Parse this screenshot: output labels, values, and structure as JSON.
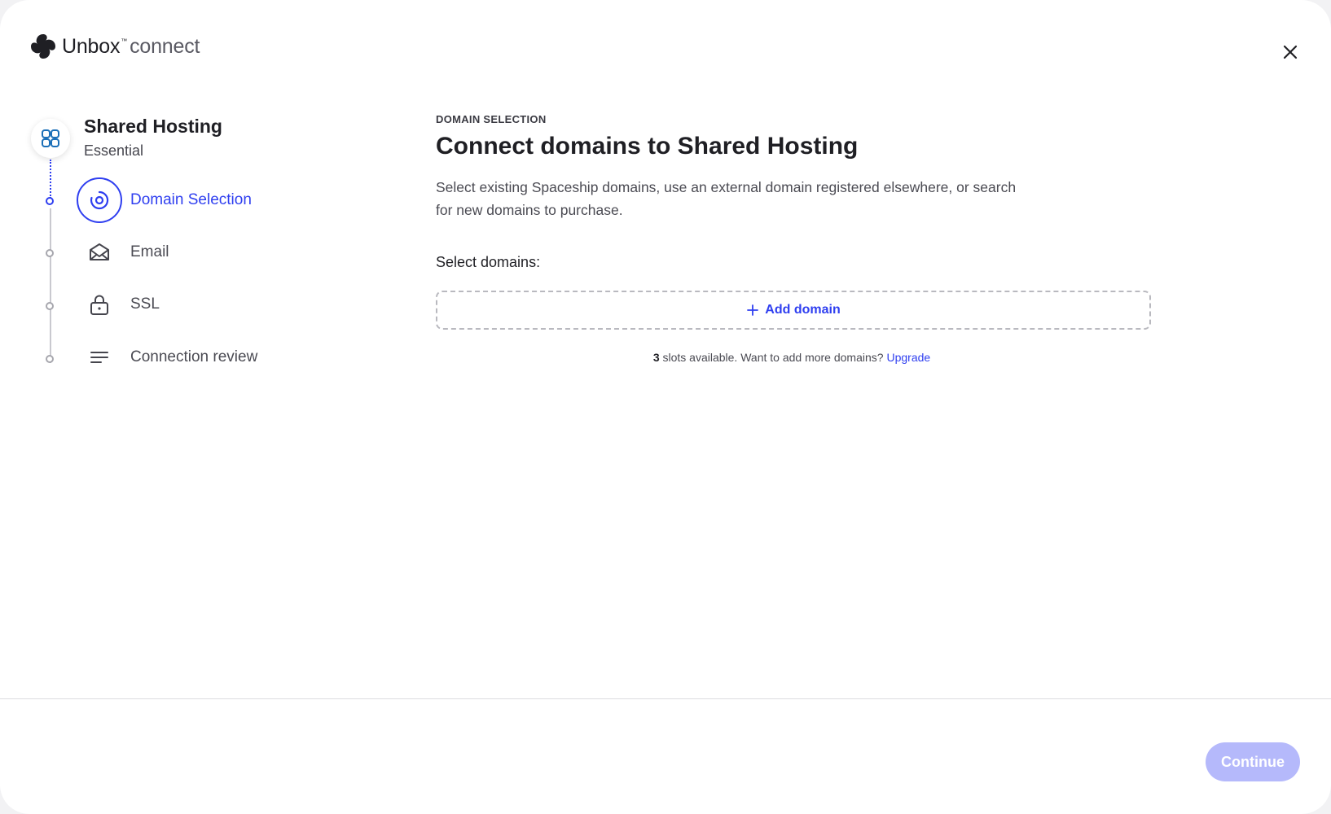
{
  "header": {
    "brand_name": "Unbox",
    "brand_tm": "™",
    "brand_sub": "connect",
    "close_icon": "close-icon"
  },
  "sidebar": {
    "product_icon": "apps-grid-icon",
    "product_title": "Shared Hosting",
    "product_plan": "Essential",
    "steps": [
      {
        "label": "Domain Selection",
        "icon": "target-icon",
        "active": true
      },
      {
        "label": "Email",
        "icon": "envelope-icon",
        "active": false
      },
      {
        "label": "SSL",
        "icon": "lock-icon",
        "active": false
      },
      {
        "label": "Connection review",
        "icon": "list-lines-icon",
        "active": false
      }
    ]
  },
  "main": {
    "eyebrow": "DOMAIN SELECTION",
    "title": "Connect domains to Shared Hosting",
    "description": "Select existing Spaceship domains, use an external domain registered elsewhere, or search for new domains to purchase.",
    "select_label": "Select domains:",
    "add_domain_label": "Add domain",
    "slots_count": "3",
    "slots_text": " slots available. Want to add more domains? ",
    "upgrade_label": "Upgrade"
  },
  "footer": {
    "continue_label": "Continue"
  },
  "colors": {
    "accent": "#2f3ff0",
    "accent_disabled": "#b5b9fb",
    "text": "#1f1f24",
    "muted": "#4b4b53"
  }
}
